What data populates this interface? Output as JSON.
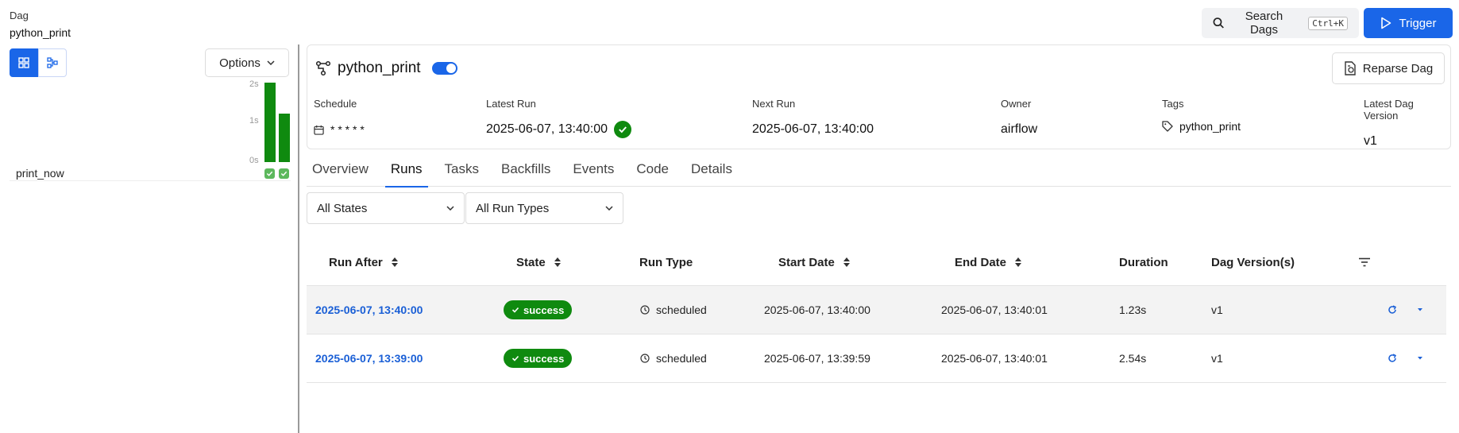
{
  "breadcrumb": {
    "label": "Dag",
    "value": "python_print"
  },
  "top_actions": {
    "search_label": "Search Dags",
    "search_shortcut": "Ctrl+K",
    "trigger_label": "Trigger"
  },
  "left_panel": {
    "options_label": "Options",
    "chart_ticks": [
      "2s",
      "1s",
      "0s"
    ],
    "run_durations": [
      2.54,
      1.23
    ],
    "task_name": "print_now"
  },
  "dag": {
    "name": "python_print",
    "paused": false,
    "reparse_label": "Reparse Dag",
    "meta": [
      {
        "label": "Schedule",
        "value": "* * * * *",
        "icon": "calendar-icon"
      },
      {
        "label": "Latest Run",
        "value": "2025-06-07, 13:40:00",
        "status": "success"
      },
      {
        "label": "Next Run",
        "value": "2025-06-07, 13:40:00"
      },
      {
        "label": "Owner",
        "value": "airflow"
      },
      {
        "label": "Tags",
        "value": "python_print",
        "icon": "tag-icon"
      },
      {
        "label": "Latest Dag Version",
        "value": "v1"
      }
    ]
  },
  "tabs": [
    "Overview",
    "Runs",
    "Tasks",
    "Backfills",
    "Events",
    "Code",
    "Details"
  ],
  "active_tab": "Runs",
  "filters": {
    "state": "All States",
    "run_type": "All Run Types"
  },
  "table": {
    "columns": [
      "Run After",
      "State",
      "Run Type",
      "Start Date",
      "End Date",
      "Duration",
      "Dag Version(s)"
    ],
    "rows": [
      {
        "run_after": "2025-06-07, 13:40:00",
        "state": "success",
        "run_type": "scheduled",
        "start": "2025-06-07, 13:40:00",
        "end": "2025-06-07, 13:40:01",
        "duration": "1.23s",
        "version": "v1"
      },
      {
        "run_after": "2025-06-07, 13:39:00",
        "state": "success",
        "run_type": "scheduled",
        "start": "2025-06-07, 13:39:59",
        "end": "2025-06-07, 13:40:01",
        "duration": "2.54s",
        "version": "v1"
      }
    ]
  },
  "colors": {
    "accent": "#1a66e8",
    "success": "#0f8a0f",
    "link": "#1a5fd6"
  }
}
